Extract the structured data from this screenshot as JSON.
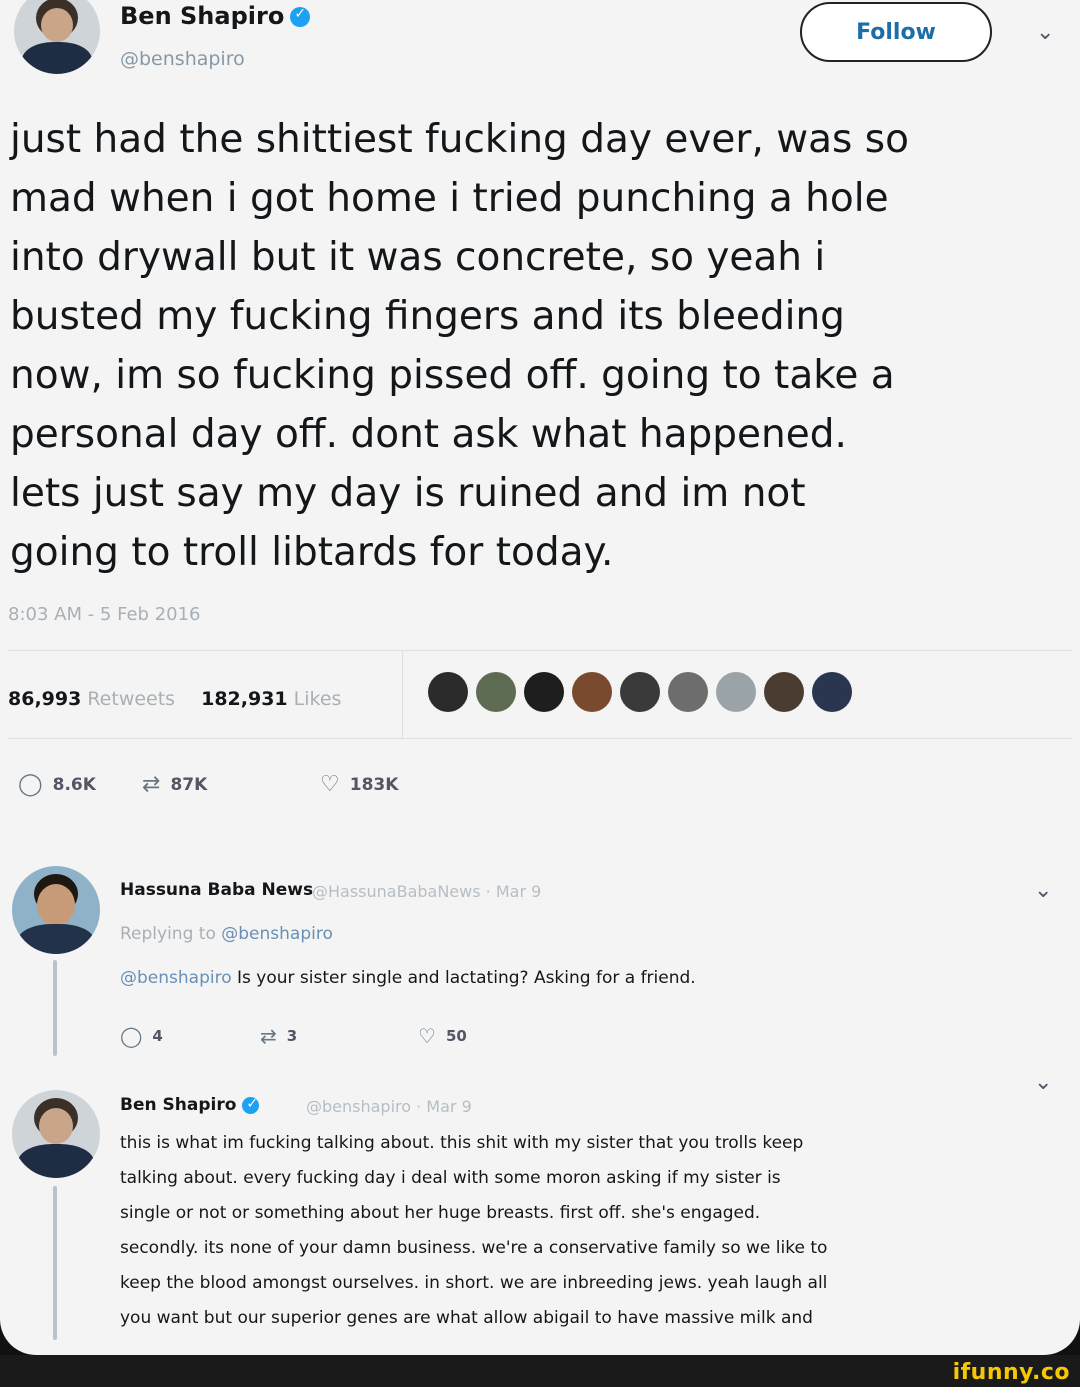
{
  "tweet": {
    "name": "Ben Shapiro",
    "handle": "@benshapiro",
    "follow_label": "Follow",
    "text": "just had the shittiest fucking day ever, was so\nmad when i got home i tried punching a hole\ninto drywall but it was concrete, so yeah i\nbusted my fucking fingers and its bleeding\nnow, im so fucking pissed off. going to take a\npersonal day off. dont ask what happened.\nlets just say my day is ruined and im not\ngoing to troll libtards for today.",
    "timestamp": "8:03 AM - 5 Feb 2016",
    "retweets_count": "86,993",
    "retweets_label": "Retweets",
    "likes_count": "182,931",
    "likes_label": "Likes",
    "reply_count": "8.6K",
    "retweet_count_short": "87K",
    "like_count_short": "183K"
  },
  "reply1": {
    "name": "Hassuna Baba News",
    "handle_date": "@HassunaBabaNews · Mar 9",
    "replying_prefix": "Replying to",
    "replying_to": "@benshapiro",
    "mention": "@benshapiro",
    "text": " Is your sister single and lactating? Asking for a friend.",
    "replies": "4",
    "retweets": "3",
    "likes": "50"
  },
  "reply2": {
    "name": "Ben Shapiro",
    "handle_date": "@benshapiro · Mar 9",
    "text": "this is what im fucking talking about. this shit with my sister that you trolls keep\ntalking about. every fucking day i deal with some moron asking if my sister is\nsingle or not or something about her huge breasts. first off. she's engaged.\nsecondly. its none of your damn business. we're a conservative family so we like to\nkeep the blood amongst ourselves. in short. we are inbreeding jews. yeah laugh all\nyou want but our superior genes are what allow abigail to have massive milk and"
  },
  "watermark": "ifunny.co",
  "colors": {
    "verified": "#1da1f2",
    "link": "#6a8fb6",
    "muted": "#a8b0b6",
    "watermark": "#f5c800"
  }
}
